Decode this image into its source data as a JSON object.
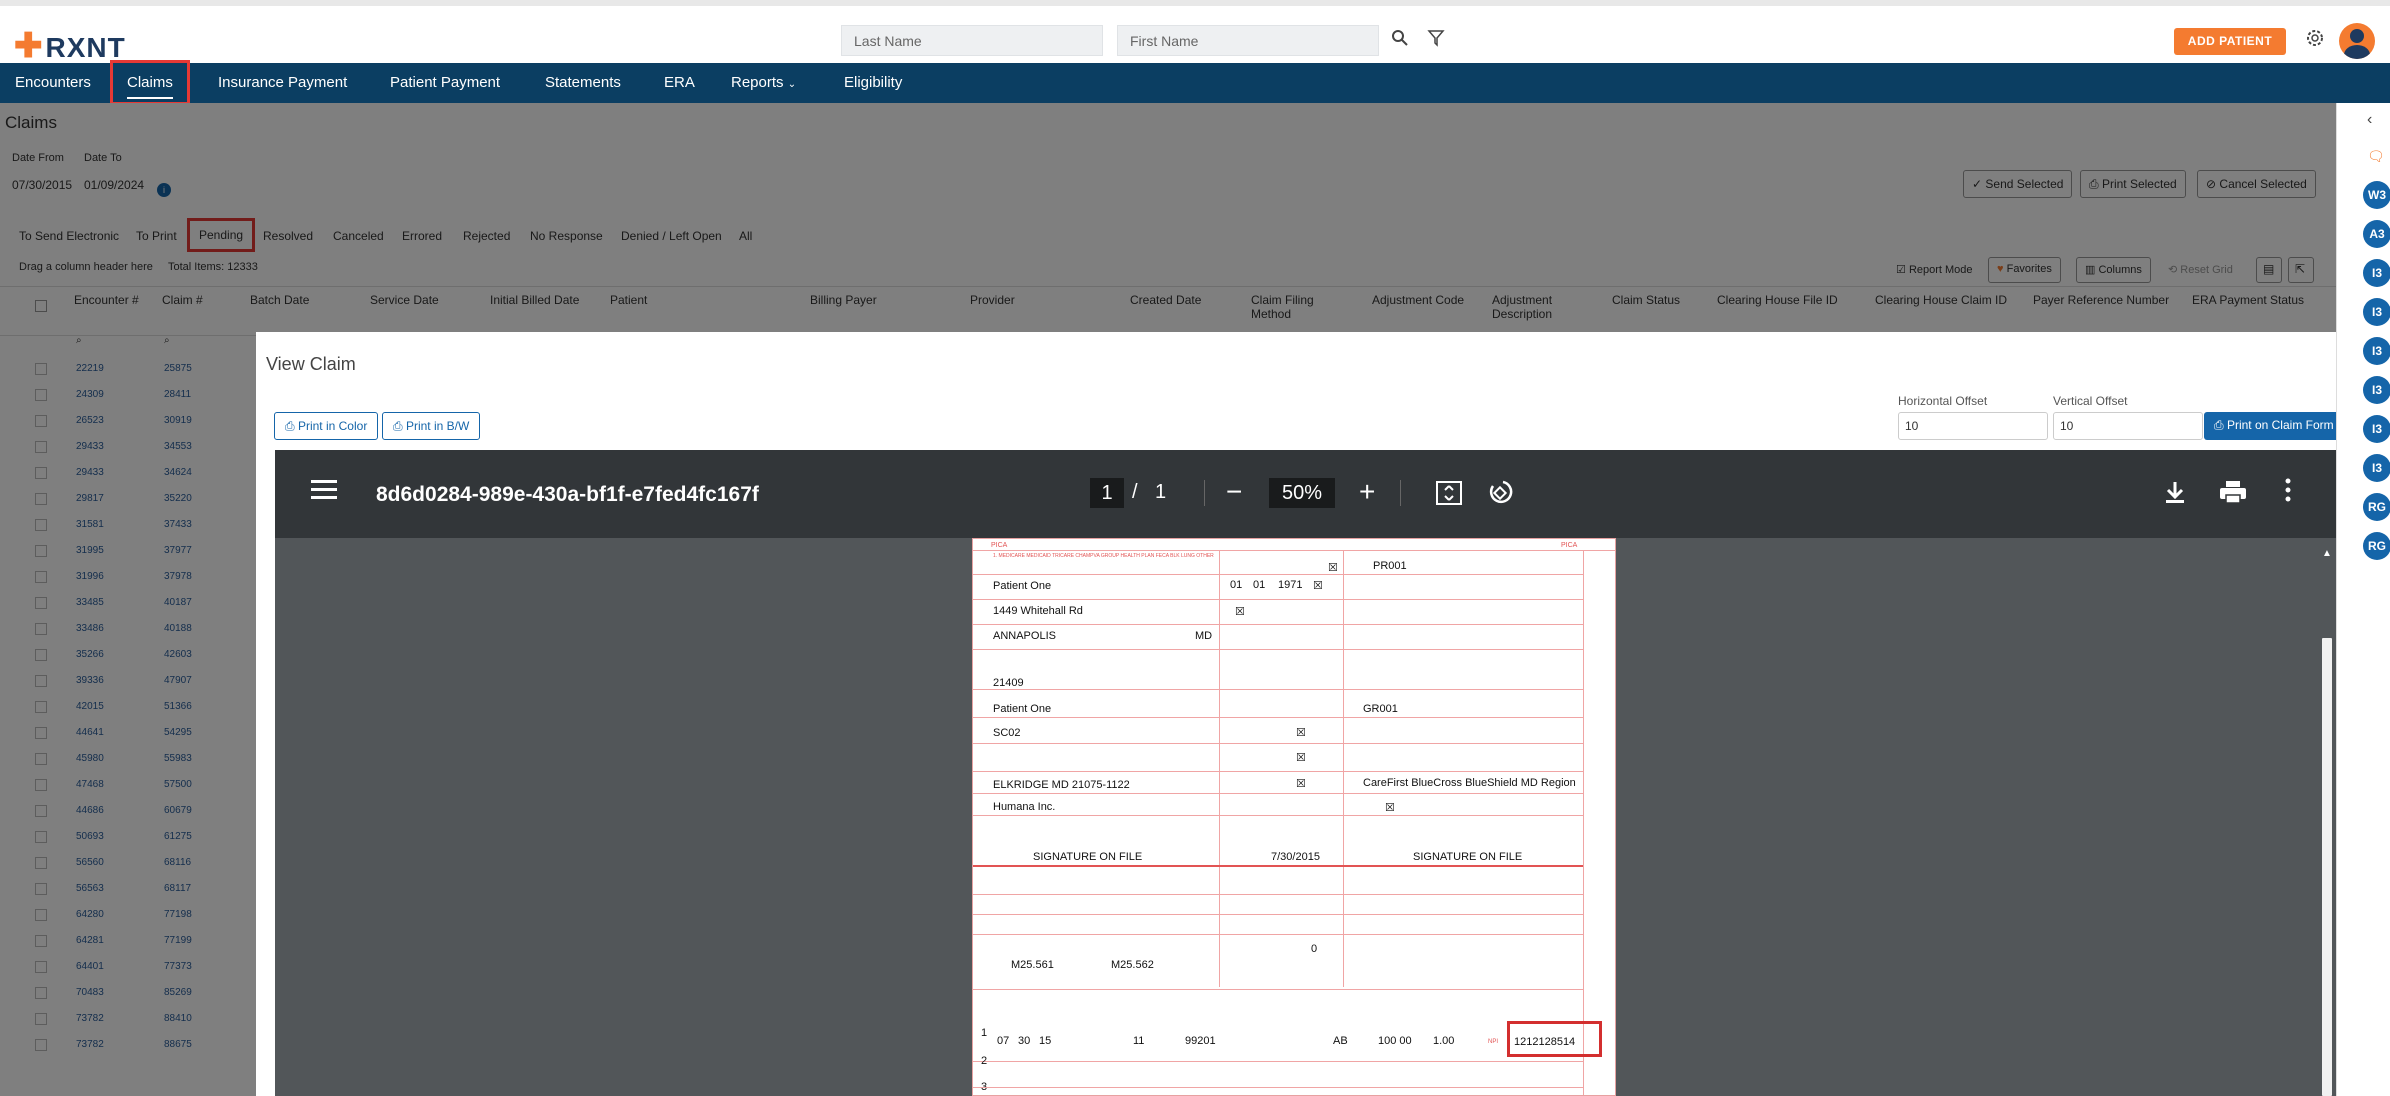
{
  "header": {
    "logo": "RXNT",
    "last_name_placeholder": "Last Name",
    "first_name_placeholder": "First Name",
    "add_patient": "ADD PATIENT"
  },
  "nav": {
    "items": [
      {
        "label": "Encounters"
      },
      {
        "label": "Claims"
      },
      {
        "label": "Insurance Payment"
      },
      {
        "label": "Patient Payment"
      },
      {
        "label": "Statements"
      },
      {
        "label": "ERA"
      },
      {
        "label": "Reports"
      },
      {
        "label": "Eligibility"
      }
    ],
    "active": "Claims"
  },
  "claims_page": {
    "title": "Claims",
    "date_from_label": "Date From",
    "date_to_label": "Date To",
    "date_from": "07/30/2015",
    "date_to": "01/09/2024",
    "buttons": {
      "send_selected": "Send Selected",
      "print_selected": "Print Selected",
      "cancel_selected": "Cancel Selected"
    },
    "filters": [
      "To Send Electronic",
      "To Print",
      "Pending",
      "Resolved",
      "Canceled",
      "Errored",
      "Rejected",
      "No Response",
      "Denied / Left Open",
      "All"
    ],
    "active_filter": "Pending",
    "drag_hint": "Drag a column header here",
    "total_items": "Total Items: 12333",
    "report_mode": "Report Mode",
    "favorites": "Favorites",
    "columns": "Columns",
    "reset_grid": "Reset Grid",
    "column_headers": [
      "Encounter #",
      "Claim #",
      "Batch Date",
      "Service Date",
      "Initial Billed Date",
      "Patient",
      "Billing Payer",
      "Provider",
      "Created Date",
      "Claim Filing Method",
      "Adjustment Code",
      "Adjustment Description",
      "Claim Status",
      "Clearing House File ID",
      "Clearing House Claim ID",
      "Payer Reference Number",
      "ERA Payment Status"
    ],
    "rows": [
      [
        "22219",
        "25875"
      ],
      [
        "24309",
        "28411"
      ],
      [
        "26523",
        "30919"
      ],
      [
        "29433",
        "34553"
      ],
      [
        "29433",
        "34624"
      ],
      [
        "29817",
        "35220"
      ],
      [
        "31581",
        "37433"
      ],
      [
        "31995",
        "37977"
      ],
      [
        "31996",
        "37978"
      ],
      [
        "33485",
        "40187"
      ],
      [
        "33486",
        "40188"
      ],
      [
        "35266",
        "42603"
      ],
      [
        "39336",
        "47907"
      ],
      [
        "42015",
        "51366"
      ],
      [
        "44641",
        "54295"
      ],
      [
        "45980",
        "55983"
      ],
      [
        "47468",
        "57500"
      ],
      [
        "44686",
        "60679"
      ],
      [
        "50693",
        "61275"
      ],
      [
        "56560",
        "68116"
      ],
      [
        "56563",
        "68117"
      ],
      [
        "64280",
        "77198"
      ],
      [
        "64281",
        "77199"
      ],
      [
        "64401",
        "77373"
      ],
      [
        "70483",
        "85269"
      ],
      [
        "73782",
        "88410"
      ],
      [
        "73782",
        "88675"
      ]
    ]
  },
  "rail": {
    "badges": [
      "W3",
      "A3",
      "I3",
      "I3",
      "I3",
      "I3",
      "I3",
      "I3",
      "RG",
      "RG"
    ]
  },
  "modal": {
    "title": "View Claim",
    "print_color": "Print in Color",
    "print_bw": "Print in B/W",
    "horizontal_offset_label": "Horizontal Offset",
    "vertical_offset_label": "Vertical Offset",
    "horizontal_offset": "10",
    "vertical_offset": "10",
    "print_on_claim_form": "Print on Claim Form"
  },
  "pdf": {
    "filename": "8d6d0284-989e-430a-bf1f-e7fed4fc167f",
    "page_current": "1",
    "page_sep": "/",
    "page_total": "1",
    "zoom": "50%"
  },
  "claim_form": {
    "pica": "PICA",
    "insured_id": "PR001",
    "patient_name": "Patient One",
    "birth_mm": "01",
    "birth_dd": "01",
    "birth_yy": "1971",
    "patient_address": "1449 Whitehall Rd",
    "city": "ANNAPOLIS",
    "state": "MD",
    "zip": "21409",
    "other_insured": "Patient One",
    "other_policy": "SC02",
    "other_address": "ELKRIDGE MD 21075-1122",
    "other_plan": "Humana Inc.",
    "insured_group": "GR001",
    "insured_plan": "CareFirst BlueCross BlueShield MD Region",
    "signature": "SIGNATURE ON FILE",
    "signature_date": "7/30/2015",
    "insured_signature": "SIGNATURE ON FILE",
    "icd_ind": "0",
    "diag_a": "M25.561",
    "diag_b": "M25.562",
    "line_number": "1",
    "line_2": "2",
    "line_3": "3",
    "svc_mm": "07",
    "svc_dd": "30",
    "svc_yy": "15",
    "place_of_service": "11",
    "cpt": "99201",
    "diag_pointer": "AB",
    "charges": "100 00",
    "units": "1.00",
    "npi_label": "NPI",
    "rendering_npi": "1212128514"
  }
}
